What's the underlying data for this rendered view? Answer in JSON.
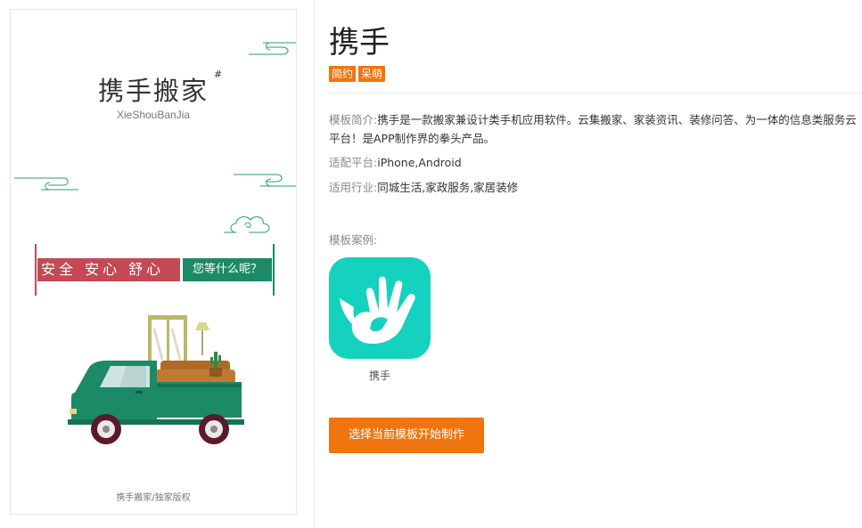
{
  "preview": {
    "title": "携手搬家",
    "title_mark": "#",
    "subtitle": "XieShouBanJia",
    "banner_red_text": "安全  安心  舒心",
    "banner_green_text": "您等什么呢？",
    "footer": "携手搬家/独家版权"
  },
  "template": {
    "title": "携手",
    "tags": [
      "简约",
      "呆萌"
    ],
    "intro_label": "模板简介:",
    "intro_text": "携手是一款搬家兼设计类手机应用软件。云集搬家、家装资讯、装修问答、为一体的信息类服务云平台！是APP制作界的拳头产品。",
    "platform_label": "适配平台:",
    "platform_text": "iPhone,Android",
    "industry_label": "适用行业:",
    "industry_text": "同城生活,家政服务,家居装修",
    "cases_label": "模板案例:",
    "case_app_name": "携手",
    "cta_label": "选择当前模板开始制作"
  },
  "colors": {
    "accent": "#f0750f",
    "app_icon_bg": "#14d2be",
    "banner_red": "#c34954",
    "banner_green": "#1c8a67",
    "truck_green": "#1c8a67"
  }
}
